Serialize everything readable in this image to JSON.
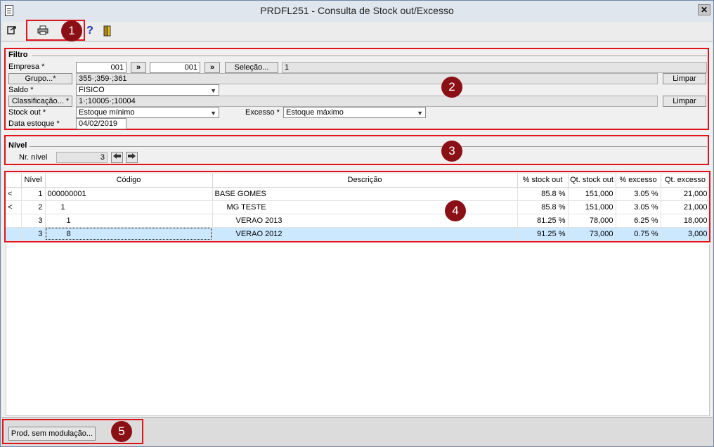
{
  "window": {
    "title": "PRDFL251 - Consulta de Stock out/Excesso",
    "close": "✕"
  },
  "toolbar": {
    "icons": [
      "exit-icon",
      "print-icon",
      "help-icon",
      "door-icon"
    ],
    "help": "?"
  },
  "annotations": [
    "1",
    "2",
    "3",
    "4",
    "5"
  ],
  "filtro": {
    "title": "Filtro",
    "empresa_label": "Empresa *",
    "empresa_from": "001",
    "empresa_to": "001",
    "range_btn": "»",
    "selecao_btn": "Seleção...",
    "selecao_value": "1",
    "grupo_btn": "Grupo...*",
    "grupo_value": "355·;359·;361",
    "limpar": "Limpar",
    "saldo_label": "Saldo *",
    "saldo_value": "FISICO",
    "classificacao_btn": "Classificação... *",
    "classificacao_value": "1·;10005·;10004",
    "stockout_label": "Stock out *",
    "stockout_value": "Estoque mínimo",
    "excesso_label": "Excesso *",
    "excesso_value": "Estoque máximo",
    "data_label": "Data estoque *",
    "data_value": "04/02/2019"
  },
  "nivel": {
    "title": "Nível",
    "nr_label": "Nr. nível",
    "nr_value": "3"
  },
  "grid": {
    "columns": [
      "",
      "Nível",
      "Código",
      "Descrição",
      "% stock out",
      "Qt. stock out",
      "% excesso",
      "Qt. excesso"
    ],
    "rows": [
      [
        "<",
        "1",
        "000000001",
        "BASE GOMES",
        "85.8 %",
        "151,000",
        "3.05 %",
        "21,000"
      ],
      [
        "<",
        "2",
        "1",
        "MG TESTE",
        "85.8 %",
        "151,000",
        "3.05 %",
        "21,000"
      ],
      [
        "",
        "3",
        "1",
        "VERAO 2013",
        "81.25 %",
        "78,000",
        "6.25 %",
        "18,000"
      ],
      [
        "",
        "3",
        "8",
        "VERAO 2012",
        "91.25 %",
        "73,000",
        "0.75 %",
        "3,000"
      ]
    ]
  },
  "footer": {
    "prod_btn": "Prod. sem modulação..."
  }
}
